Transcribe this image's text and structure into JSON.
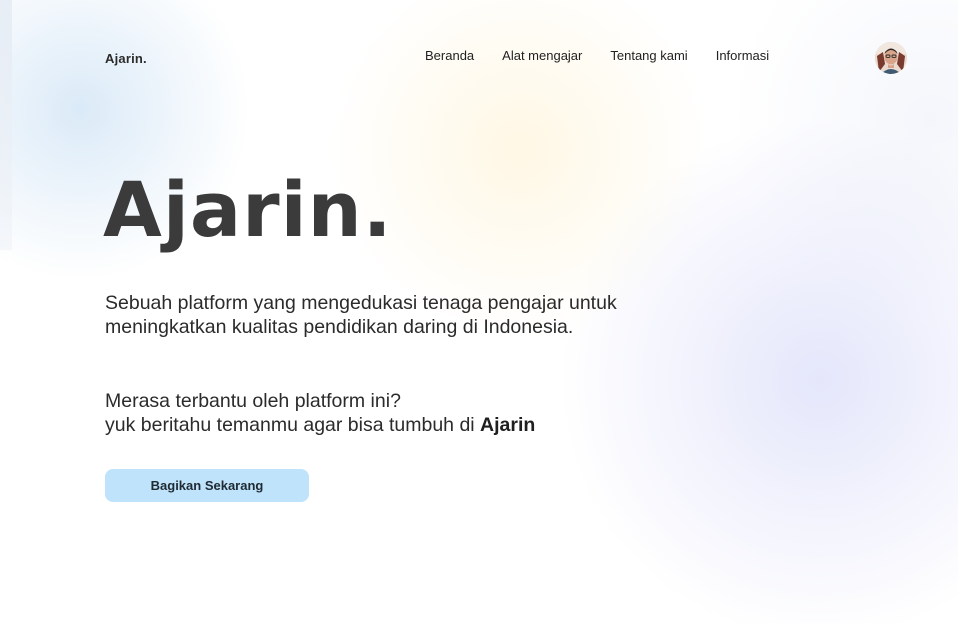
{
  "nav": {
    "brand": "Ajarin.",
    "links": [
      {
        "label": "Beranda"
      },
      {
        "label": "Alat mengajar"
      },
      {
        "label": "Tentang kami"
      },
      {
        "label": "Informasi"
      }
    ]
  },
  "hero": {
    "title": "Ajarin.",
    "description": "Sebuah platform yang mengedukasi tenaga pengajar untuk meningkatkan kualitas pendidikan daring di Indonesia.",
    "cta_line1": "Merasa terbantu oleh platform ini?",
    "cta_line2_prefix": "yuk beritahu temanmu agar bisa tumbuh di ",
    "cta_line2_brand": "Ajarin",
    "button_label": "Bagikan Sekarang"
  },
  "colors": {
    "button_bg": "#bfe3fb",
    "title_text": "#3b3b3b",
    "body_text": "#2b2b2b"
  }
}
